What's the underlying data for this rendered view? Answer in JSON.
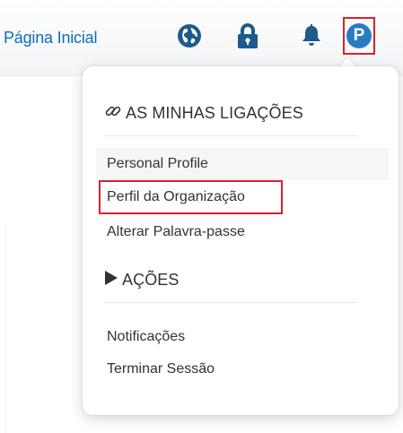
{
  "header": {
    "home_label": "Página Inicial",
    "icons": [
      "globe-icon",
      "lock-icon",
      "bell-icon"
    ],
    "avatar_letter": "P",
    "link_color": "#0d6eb5",
    "icon_color": "#1e5a8c",
    "avatar_color": "#2a7cc0",
    "highlight_color": "#d9222a"
  },
  "dropdown": {
    "links_section": {
      "title": "AS MINHAS LIGAÇÕES",
      "icon": "link-icon",
      "items": [
        {
          "label": "Personal Profile"
        },
        {
          "label": "Perfil da Organização"
        },
        {
          "label": "Alterar Palavra-passe"
        }
      ]
    },
    "actions_section": {
      "title": "AÇÕES",
      "icon": "play-triangle-icon",
      "items": [
        {
          "label": "Notificações"
        },
        {
          "label": "Terminar Sessão"
        }
      ]
    }
  }
}
